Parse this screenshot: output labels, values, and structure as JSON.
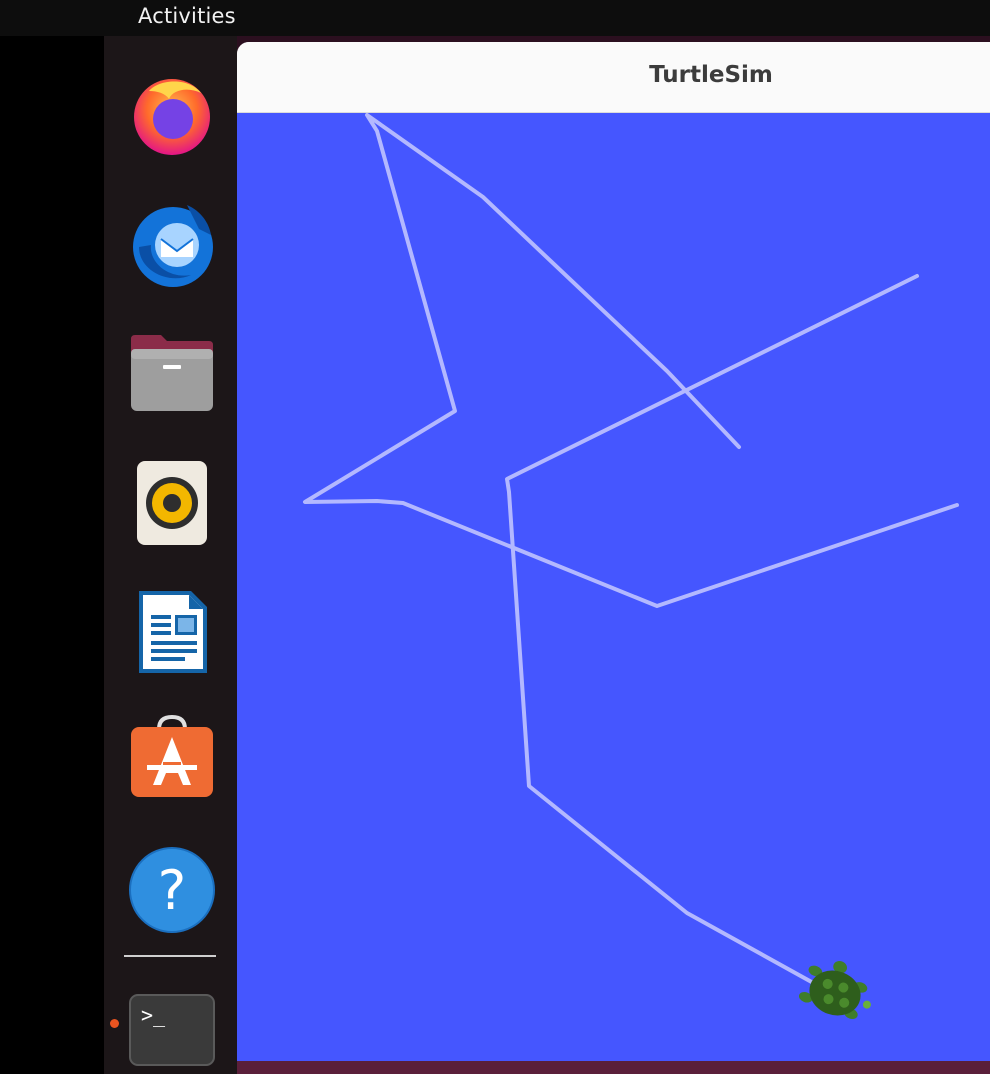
{
  "topbar": {
    "activities_label": "Activities"
  },
  "dock": {
    "items": [
      {
        "name": "Firefox Web Browser",
        "icon": "firefox-icon"
      },
      {
        "name": "Thunderbird Mail",
        "icon": "thunderbird-icon"
      },
      {
        "name": "Files",
        "icon": "files-icon"
      },
      {
        "name": "Rhythmbox",
        "icon": "rhythmbox-icon"
      },
      {
        "name": "LibreOffice Writer",
        "icon": "writer-icon"
      },
      {
        "name": "Ubuntu Software",
        "icon": "software-icon"
      },
      {
        "name": "Help",
        "icon": "help-icon"
      },
      {
        "name": "Terminal",
        "icon": "terminal-icon",
        "running": true
      }
    ],
    "help_glyph": "?",
    "terminal_glyph": ">_",
    "accent_color": "#e95420"
  },
  "window": {
    "title": "TurtleSim",
    "background_color": "#4556ff",
    "pen_color": "#b3b8ff"
  }
}
